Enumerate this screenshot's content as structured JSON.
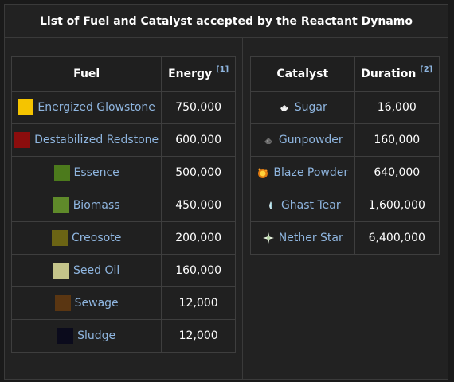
{
  "title": "List of Fuel and Catalyst accepted by the Reactant Dynamo",
  "fuel_table": {
    "headers": {
      "fuel": "Fuel",
      "energy": "Energy",
      "energy_ref": "[1]"
    },
    "rows": [
      {
        "name": "Energized Glowstone",
        "value": "750,000",
        "color": "#f5c400",
        "icon": "energized-glowstone-icon"
      },
      {
        "name": "Destabilized Redstone",
        "value": "600,000",
        "color": "#8b0d0d",
        "icon": "destabilized-redstone-icon"
      },
      {
        "name": "Essence",
        "value": "500,000",
        "color": "#4c7a1c",
        "icon": "essence-icon"
      },
      {
        "name": "Biomass",
        "value": "450,000",
        "color": "#5f8a2a",
        "icon": "biomass-icon"
      },
      {
        "name": "Creosote",
        "value": "200,000",
        "color": "#6b6414",
        "icon": "creosote-icon"
      },
      {
        "name": "Seed Oil",
        "value": "160,000",
        "color": "#c4c48a",
        "icon": "seed-oil-icon"
      },
      {
        "name": "Sewage",
        "value": "12,000",
        "color": "#5a3612",
        "icon": "sewage-icon"
      },
      {
        "name": "Sludge",
        "value": "12,000",
        "color": "#0b0b1c",
        "icon": "sludge-icon"
      }
    ]
  },
  "catalyst_table": {
    "headers": {
      "catalyst": "Catalyst",
      "duration": "Duration",
      "duration_ref": "[2]"
    },
    "rows": [
      {
        "name": "Sugar",
        "value": "16,000",
        "icon": "sugar-icon"
      },
      {
        "name": "Gunpowder",
        "value": "160,000",
        "icon": "gunpowder-icon"
      },
      {
        "name": "Blaze Powder",
        "value": "640,000",
        "icon": "blaze-powder-icon"
      },
      {
        "name": "Ghast Tear",
        "value": "1,600,000",
        "icon": "ghast-tear-icon"
      },
      {
        "name": "Nether Star",
        "value": "6,400,000",
        "icon": "nether-star-icon"
      }
    ]
  }
}
